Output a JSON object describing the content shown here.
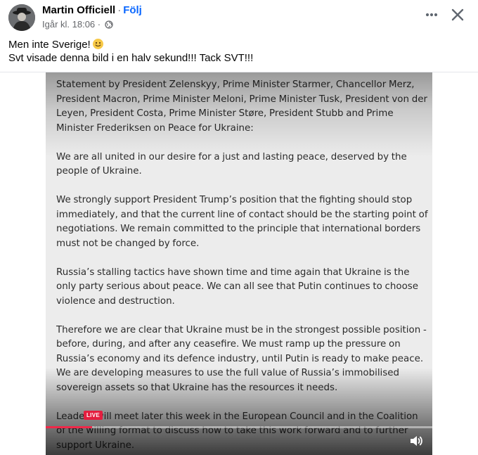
{
  "post": {
    "author": "Martin Officiell",
    "separator": "·",
    "follow_label": "Följ",
    "timestamp": "Igår kl. 18:06",
    "meta_separator": "·",
    "audience_icon": "globe-icon",
    "caption_line1": "Men inte Sverige!",
    "caption_emoji": "slightly-smiling-face",
    "caption_line2": "Svt visade denna bild i en halv sekund!!! Tack SVT!!!"
  },
  "video": {
    "live_label": "LIVE",
    "progress": 0.12,
    "volume_icon": "speaker-icon",
    "document": {
      "heading": "Statement by President Zelenskyy, Prime Minister Starmer, Chancellor Merz, President Macron, Prime Minister Meloni, Prime Minister Tusk,  President von der Leyen, President Costa, Prime Minister Støre, President Stubb and Prime Minister Frederiksen on Peace for Ukraine:",
      "paragraphs": [
        "We are all united in our desire for a just and lasting peace, deserved by the people of Ukraine.",
        "We strongly support President Trump’s position that the fighting should stop immediately, and that the current line of contact should be the starting point of negotiations. We remain committed to the principle that international borders must not be changed by force.",
        "Russia’s stalling tactics have shown time and time again that Ukraine is the only party serious about peace. We can all see that Putin continues to choose violence and destruction.",
        "Therefore we are clear that Ukraine must be in the strongest possible position - before, during, and after any ceasefire. We must ramp up the pressure on Russia’s economy and its defence industry, until Putin is ready to make peace. We are developing measures to use the full value of Russia’s immobilised sovereign assets so that Ukraine has the resources it needs.",
        "Leaders will meet later this week in the European Council and in the Coalition of the willing format to discuss how to take this work forward and to further support Ukraine."
      ]
    }
  },
  "icons": {
    "avatar": "profile-avatar",
    "more": "more-horizontal-icon",
    "close": "close-icon"
  },
  "colors": {
    "accent": "#0866ff",
    "muted_text": "#65676b",
    "live_red": "#e41e3f",
    "progress_red": "#f02849"
  }
}
